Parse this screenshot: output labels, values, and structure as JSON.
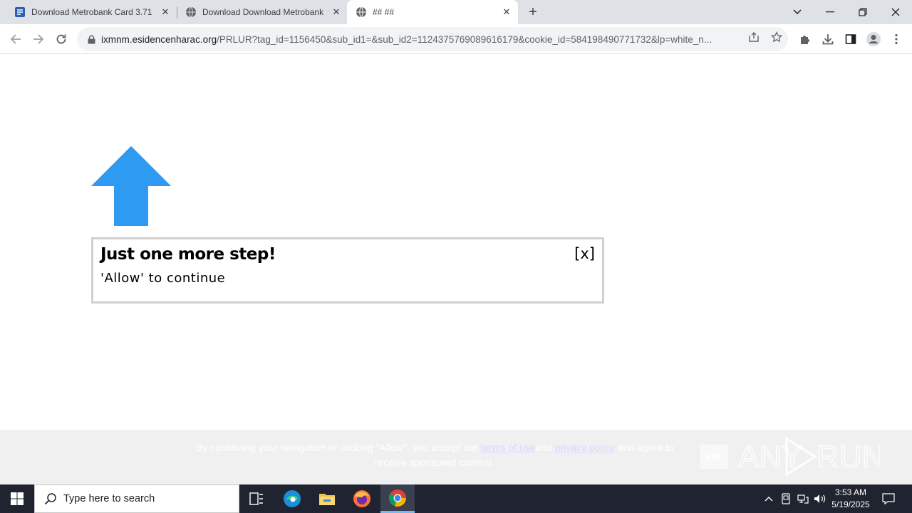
{
  "browser": {
    "tabs": [
      {
        "title": "Download Metrobank Card 3.71",
        "icon": "app-favicon-icon",
        "active": false
      },
      {
        "title": "Download Download Metrobank",
        "icon": "globe-icon",
        "active": false
      },
      {
        "title": "## ##",
        "icon": "globe-icon",
        "active": true
      }
    ],
    "new_tab_label": "+",
    "url_host": "ixmnm.esidencenharac.org",
    "url_path": "/PRLUR?tag_id=1156450&sub_id1=&sub_id2=1124375769089616179&cookie_id=584198490771732&lp=white_n...",
    "accent": "#1a73e8"
  },
  "page": {
    "arrow_color": "#2f9af2",
    "popup": {
      "heading": "Just one more step!",
      "subtext": "'Allow' to continue",
      "close_label": "[x]"
    },
    "consent": {
      "text_before": "By continuing your navigation or clicking \"Allow\", you accept our",
      "terms_link": "terms of use",
      "text_mid": "and",
      "privacy_link": "privacy policy",
      "text_after": "and agree to receive sponsored content.",
      "ok_label": "OK"
    },
    "watermark": "ANY RUN"
  },
  "taskbar": {
    "search_placeholder": "Type here to search",
    "apps": [
      "task-view-icon",
      "edge-icon",
      "file-explorer-icon",
      "firefox-icon",
      "chrome-icon"
    ],
    "time": "3:53 AM",
    "date": "5/19/2025"
  }
}
